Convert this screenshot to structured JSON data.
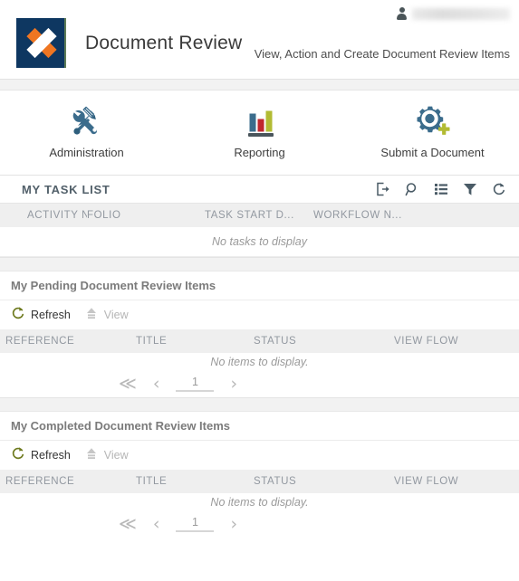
{
  "header": {
    "logo_name": "x-logo",
    "title": "Document Review",
    "subtitle": "View, Action and Create Document Review Items",
    "user_name": "",
    "user_icon": "user-icon",
    "colors": {
      "logo_background": "#0e3761",
      "logo_orange": "#ef7622",
      "logo_white": "#ffffff",
      "logo_edge": "#5d7c57"
    }
  },
  "nav": {
    "tiles": [
      {
        "label": "Administration",
        "icon": "tools-icon"
      },
      {
        "label": "Reporting",
        "icon": "bar-chart-icon"
      },
      {
        "label": "Submit a Document",
        "icon": "gear-plus-icon"
      }
    ]
  },
  "task_list": {
    "title": "MY TASK LIST",
    "tools": [
      {
        "name": "export-icon",
        "label": "Export"
      },
      {
        "name": "search-icon",
        "label": "Search"
      },
      {
        "name": "list-icon",
        "label": "List View"
      },
      {
        "name": "filter-icon",
        "label": "Filter"
      },
      {
        "name": "refresh-icon",
        "label": "Refresh"
      }
    ],
    "columns": [
      "ACTIVITY NAME",
      "FOLIO",
      "TASK START D...",
      "WORKFLOW N..."
    ],
    "empty_text": "No tasks to display"
  },
  "pending_section": {
    "title": "My Pending Document Review Items",
    "refresh_label": "Refresh",
    "view_label": "View",
    "refresh_icon": "refresh-icon",
    "view_icon": "upload-arrow-icon",
    "columns": [
      "REFERENCE",
      "TITLE",
      "STATUS",
      "VIEW FLOW"
    ],
    "empty_text": "No items to display.",
    "pagination": {
      "first_label": "≪",
      "prev_label": "‹",
      "next_label": "›",
      "page": "1"
    }
  },
  "completed_section": {
    "title": "My Completed Document Review Items",
    "refresh_label": "Refresh",
    "view_label": "View",
    "refresh_icon": "refresh-icon",
    "view_icon": "upload-arrow-icon",
    "columns": [
      "REFERENCE",
      "TITLE",
      "STATUS",
      "VIEW FLOW"
    ],
    "empty_text": "No items to display.",
    "pagination": {
      "first_label": "≪",
      "prev_label": "‹",
      "next_label": "›",
      "page": "1"
    }
  },
  "theme": {
    "accent_blue": "#3b6c8c",
    "accent_olive": "#6e7a1e",
    "header_text": "#52606a",
    "muted_text": "#9298a0",
    "band_gray": "#f2f2f2"
  }
}
